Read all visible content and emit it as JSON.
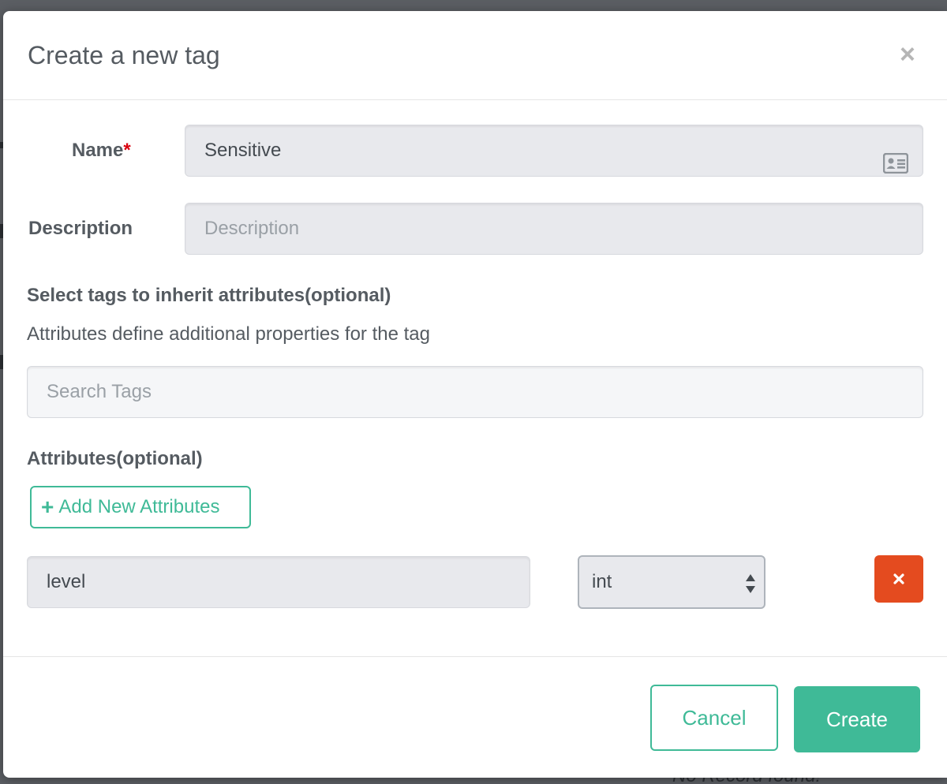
{
  "dialog": {
    "title": "Create a new tag",
    "close_glyph": "×"
  },
  "form": {
    "name_label": "Name",
    "required_marker": "*",
    "name_value": "Sensitive",
    "name_icon": "id-card-icon",
    "description_label": "Description",
    "description_value": "",
    "description_placeholder": "Description",
    "inherit_heading": "Select tags to inherit attributes(optional)",
    "inherit_help": "Attributes define additional properties for the tag",
    "search_value": "",
    "search_placeholder": "Search Tags",
    "attributes_heading": "Attributes(optional)",
    "add_attributes_label": "Add New Attributes",
    "attribute_rows": [
      {
        "name": "level",
        "type": "int"
      }
    ]
  },
  "footer": {
    "cancel_label": "Cancel",
    "create_label": "Create"
  },
  "backdrop": {
    "text": "No Record found!"
  },
  "colors": {
    "accent": "#3fba97",
    "danger": "#e44b1f",
    "required": "#d9000d"
  }
}
